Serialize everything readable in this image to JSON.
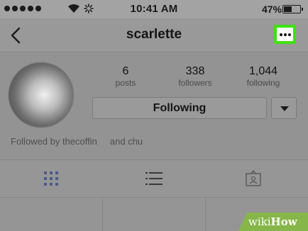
{
  "status_bar": {
    "time": "10:41 AM",
    "battery_percent": "47%",
    "battery_level": 0.47
  },
  "nav": {
    "title": "scarlette"
  },
  "profile": {
    "stats": [
      {
        "value": "6",
        "label": "posts"
      },
      {
        "value": "338",
        "label": "followers"
      },
      {
        "value": "1,044",
        "label": "following"
      }
    ],
    "following_button_label": "Following",
    "followed_by_text": "Followed by thecoffin",
    "followed_by_and": "and chu"
  },
  "tabs": [
    "grid-icon",
    "list-icon",
    "tagged-photos-icon"
  ],
  "accent_color": "#3ee10f",
  "watermark": {
    "prefix": "wiki",
    "suffix": "How"
  }
}
